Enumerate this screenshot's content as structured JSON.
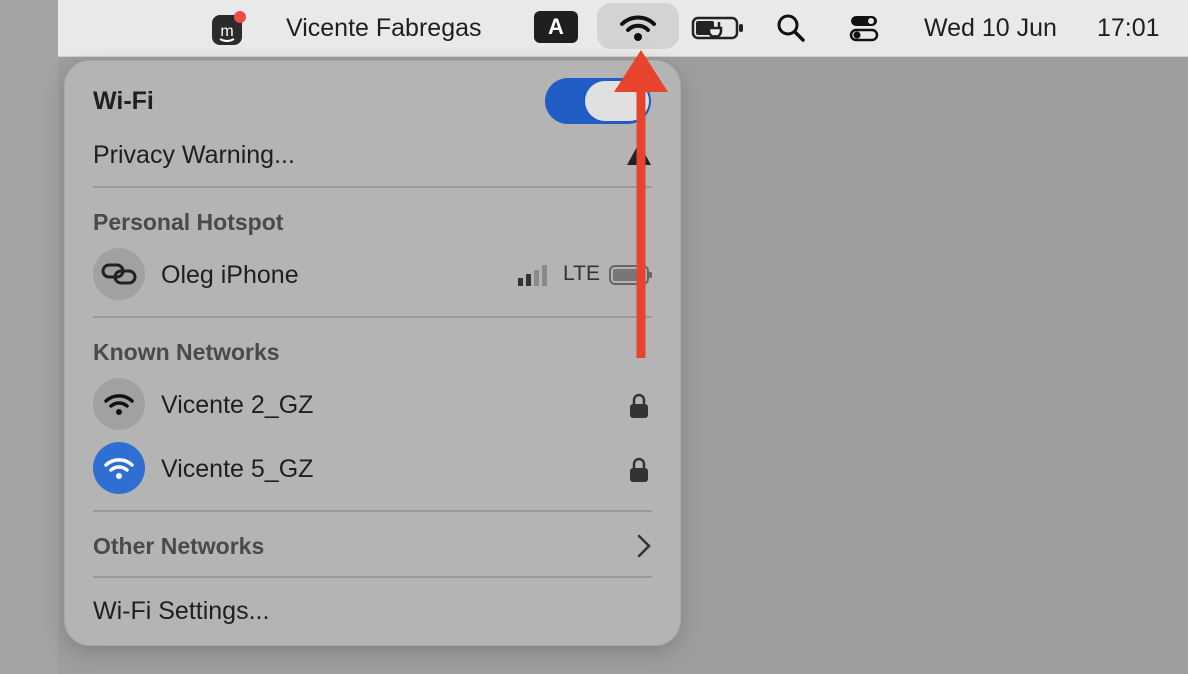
{
  "menubar": {
    "user_name": "Vicente Fabregas",
    "input_source": "A",
    "date": "Wed 10 Jun",
    "time": "17:01"
  },
  "wifi_menu": {
    "title": "Wi-Fi",
    "toggle_on": true,
    "privacy_warning": "Privacy Warning...",
    "personal_hotspot": {
      "header": "Personal Hotspot",
      "device": "Oleg iPhone",
      "network_type": "LTE"
    },
    "known_networks": {
      "header": "Known Networks",
      "items": [
        {
          "name": "Vicente 2_GZ",
          "secured": true,
          "connected": false
        },
        {
          "name": "Vicente 5_GZ",
          "secured": true,
          "connected": true
        }
      ]
    },
    "other_networks": "Other Networks",
    "settings": "Wi-Fi Settings..."
  },
  "colors": {
    "accent_blue": "#1f5cc4",
    "annotation_arrow": "#e8432d"
  }
}
